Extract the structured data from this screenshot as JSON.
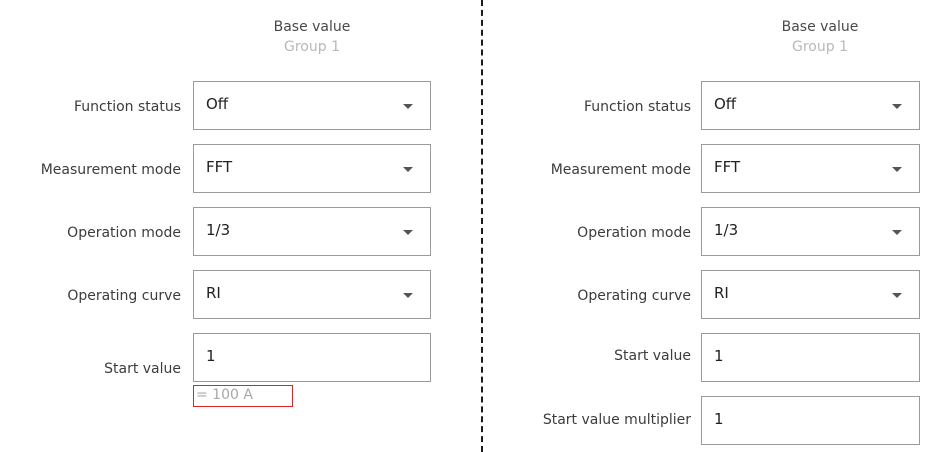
{
  "left_panel": {
    "header": {
      "title": "Base value",
      "group": "Group 1"
    },
    "rows": [
      {
        "label": "Function status",
        "value": "Off",
        "type": "dropdown"
      },
      {
        "label": "Measurement mode",
        "value": "FFT",
        "type": "dropdown"
      },
      {
        "label": "Operation mode",
        "value": "1/3",
        "type": "dropdown"
      },
      {
        "label": "Operating curve",
        "value": "RI",
        "type": "dropdown"
      },
      {
        "label": "Start value",
        "value": "1",
        "type": "input"
      }
    ],
    "start_value_hint": "= 100 A"
  },
  "right_panel": {
    "header": {
      "title": "Base value",
      "group": "Group 1"
    },
    "rows": [
      {
        "label": "Function status",
        "value": "Off",
        "type": "dropdown"
      },
      {
        "label": "Measurement mode",
        "value": "FFT",
        "type": "dropdown"
      },
      {
        "label": "Operation mode",
        "value": "1/3",
        "type": "dropdown"
      },
      {
        "label": "Operating curve",
        "value": "RI",
        "type": "dropdown"
      },
      {
        "label": "Start value",
        "value": "1",
        "type": "input"
      },
      {
        "label": "Start value multiplier",
        "value": "1",
        "type": "input"
      }
    ]
  },
  "colors": {
    "field_border": "#9a9a9a",
    "group_label": "#b8b8b8",
    "highlight_box": "#e02424",
    "hint_text": "#a8a8a8"
  }
}
